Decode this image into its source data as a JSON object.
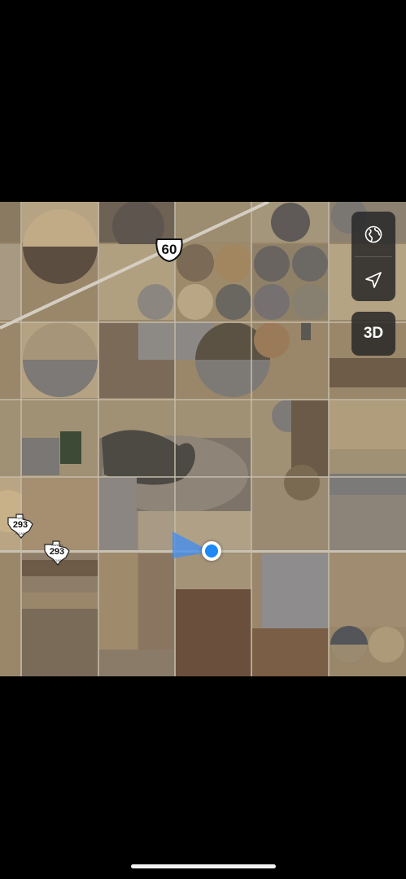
{
  "map": {
    "highway_shield": "60",
    "farm_road_shields": [
      {
        "number": "293",
        "top_text": "FARM",
        "bottom_text": "ROAD"
      },
      {
        "number": "293",
        "top_text": "RANCH",
        "bottom_text": "ROAD"
      }
    ],
    "colors": {
      "location_dot": "#1e88f5",
      "heading_cone": "#3f8ef2",
      "control_background": "#282828"
    }
  },
  "controls": {
    "globe_icon": "globe-icon",
    "location_icon": "location-arrow-icon",
    "view_3d_label": "3D"
  }
}
